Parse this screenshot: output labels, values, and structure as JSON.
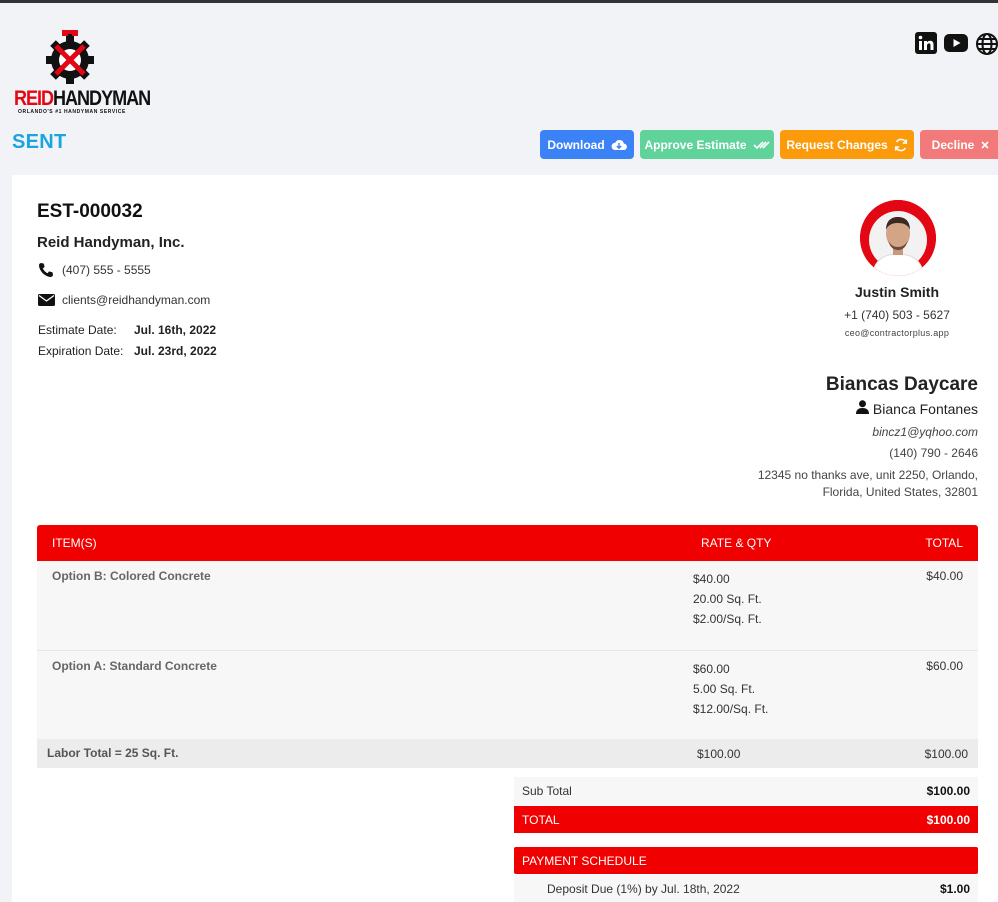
{
  "company": {
    "logo_brand_red": "REID",
    "logo_brand_dark": "HANDYMAN",
    "logo_tagline": "ORLANDO'S #1 HANDYMAN SERVICE",
    "name": "Reid Handyman, Inc.",
    "phone": "(407) 555 - 5555",
    "email": "clients@reidhandyman.com"
  },
  "social": [
    "linkedin-icon",
    "youtube-icon",
    "globe-icon"
  ],
  "status": "SENT",
  "actions": {
    "download": "Download",
    "approve": "Approve Estimate",
    "request": "Request Changes",
    "decline": "Decline"
  },
  "estimate": {
    "id": "EST-000032",
    "date_label": "Estimate Date:",
    "date_value": "Jul. 16th, 2022",
    "expiration_label": "Expiration Date:",
    "expiration_value": "Jul. 23rd, 2022"
  },
  "rep": {
    "name": "Justin Smith",
    "phone": "+1 (740) 503 - 5627",
    "email": "ceo@contractorplus.app"
  },
  "client": {
    "business": "Biancas Daycare",
    "contact": "Bianca Fontanes",
    "email": "bincz1@yqhoo.com",
    "phone": "(140) 790 - 2646",
    "address_line1": "12345 no thanks ave, unit 2250, Orlando,",
    "address_line2": "Florida, United States, 32801"
  },
  "table": {
    "headers": {
      "item": "ITEM(S)",
      "rate": "RATE & QTY",
      "total": "TOTAL"
    },
    "rows": [
      {
        "name": "Option B: Colored Concrete",
        "rate": "$40.00",
        "qty": "20.00 Sq. Ft.",
        "unit": "$2.00/Sq. Ft.",
        "total": "$40.00"
      },
      {
        "name": "Option A: Standard Concrete",
        "rate": "$60.00",
        "qty": "5.00 Sq. Ft.",
        "unit": "$12.00/Sq. Ft.",
        "total": "$60.00"
      }
    ],
    "labor": {
      "name": "Labor Total = 25 Sq. Ft.",
      "rate": "$100.00",
      "total": "$100.00"
    }
  },
  "totals": {
    "sub_total_label": "Sub Total",
    "sub_total_value": "$100.00",
    "total_label": "TOTAL",
    "total_value": "$100.00"
  },
  "payment": {
    "header": "PAYMENT SCHEDULE",
    "deposit_label": "Deposit Due (1%) by Jul. 18th, 2022",
    "deposit_value": "$1.00"
  },
  "colors": {
    "brand_red": "#f00000",
    "status_blue": "#1ba5e0",
    "download_blue": "#3b82f6",
    "approve_green": "#5fd39a",
    "request_orange": "#fb9a0b",
    "decline_red": "#f27a7a"
  }
}
